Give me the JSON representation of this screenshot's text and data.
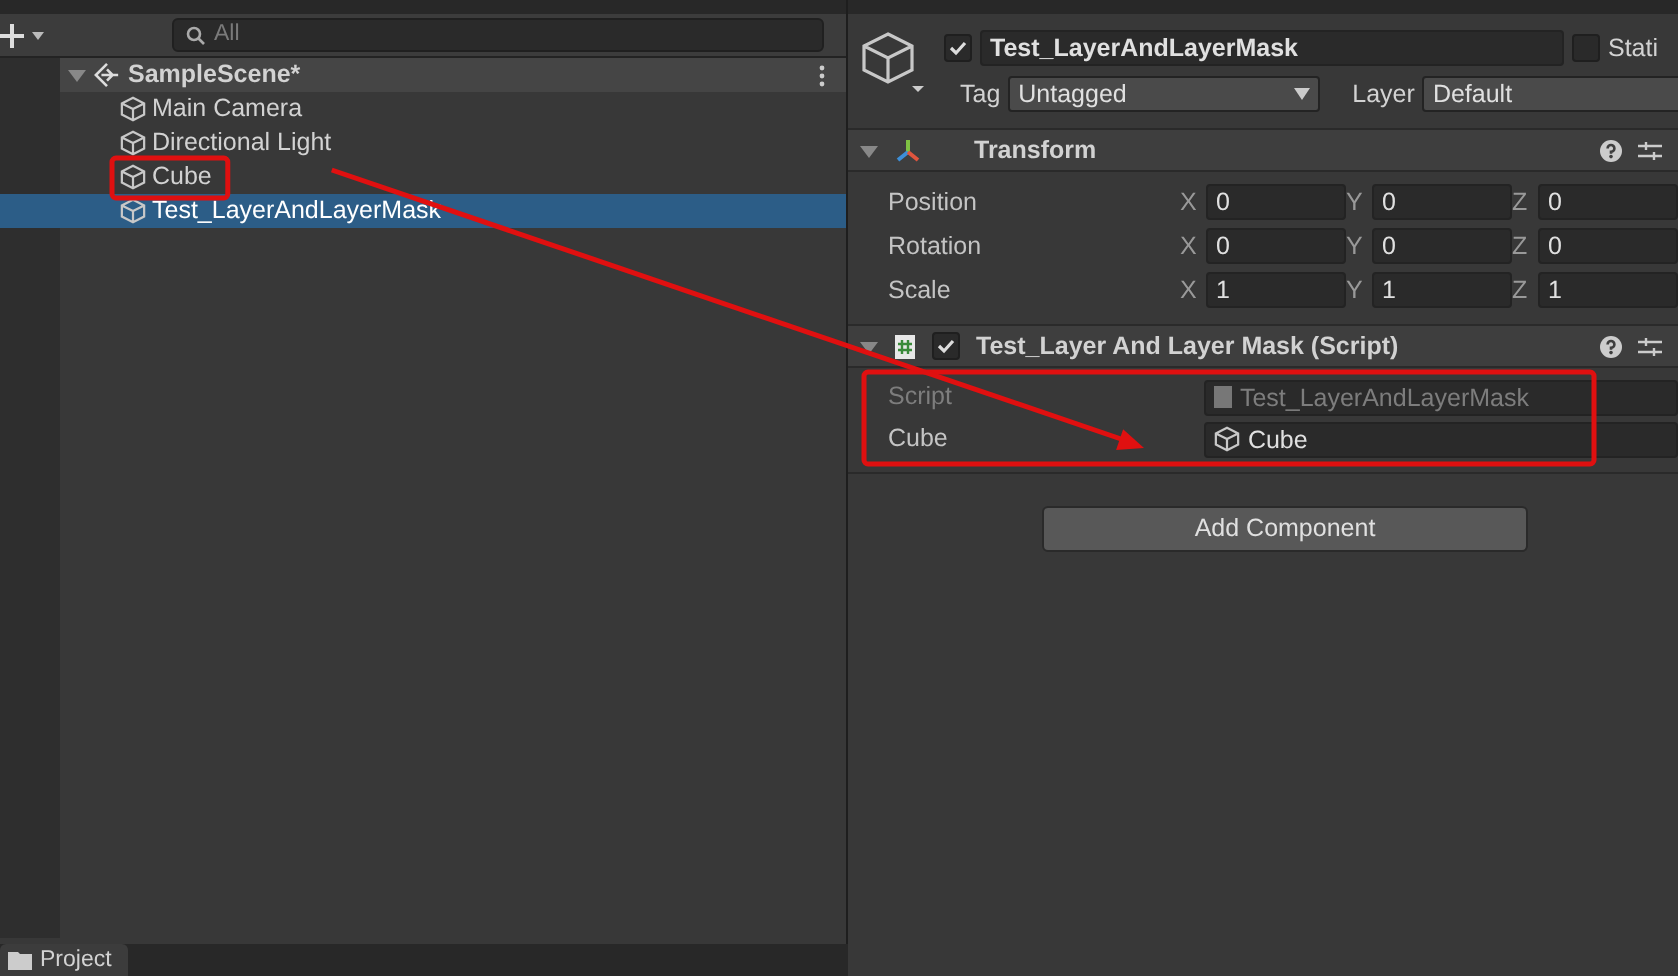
{
  "hierarchy": {
    "search": {
      "placeholder": "All"
    },
    "scene": {
      "name": "SampleScene*",
      "expanded": true,
      "children": [
        {
          "name": "Main Camera",
          "selected": false,
          "highlighted": false
        },
        {
          "name": "Directional Light",
          "selected": false,
          "highlighted": false
        },
        {
          "name": "Cube",
          "selected": false,
          "highlighted": true
        },
        {
          "name": "Test_LayerAndLayerMask",
          "selected": true,
          "highlighted": false
        }
      ]
    }
  },
  "inspector": {
    "object": {
      "active": true,
      "name": "Test_LayerAndLayerMask",
      "static_label": "Stati",
      "static": false,
      "tag_label": "Tag",
      "tag": "Untagged",
      "layer_label": "Layer",
      "layer": "Default"
    },
    "components": [
      {
        "kind": "transform",
        "title": "Transform",
        "expanded": true,
        "rows": [
          {
            "label": "Position",
            "fields": [
              {
                "axis": "X",
                "value": "0"
              },
              {
                "axis": "Y",
                "value": "0"
              },
              {
                "axis": "Z",
                "value": "0"
              }
            ]
          },
          {
            "label": "Rotation",
            "fields": [
              {
                "axis": "X",
                "value": "0"
              },
              {
                "axis": "Y",
                "value": "0"
              },
              {
                "axis": "Z",
                "value": "0"
              }
            ]
          },
          {
            "label": "Scale",
            "fields": [
              {
                "axis": "X",
                "value": "1"
              },
              {
                "axis": "Y",
                "value": "1"
              },
              {
                "axis": "Z",
                "value": "1"
              }
            ]
          }
        ]
      },
      {
        "kind": "script",
        "title": "Test_Layer And Layer Mask (Script)",
        "enabled": true,
        "expanded": true,
        "highlighted": true,
        "rows": [
          {
            "label": "Script",
            "value": "Test_LayerAndLayerMask",
            "disabled": true
          },
          {
            "label": "Cube",
            "value": "Cube",
            "disabled": false
          }
        ]
      }
    ],
    "add_component": "Add Component"
  },
  "project_tab": {
    "label": "Project"
  }
}
